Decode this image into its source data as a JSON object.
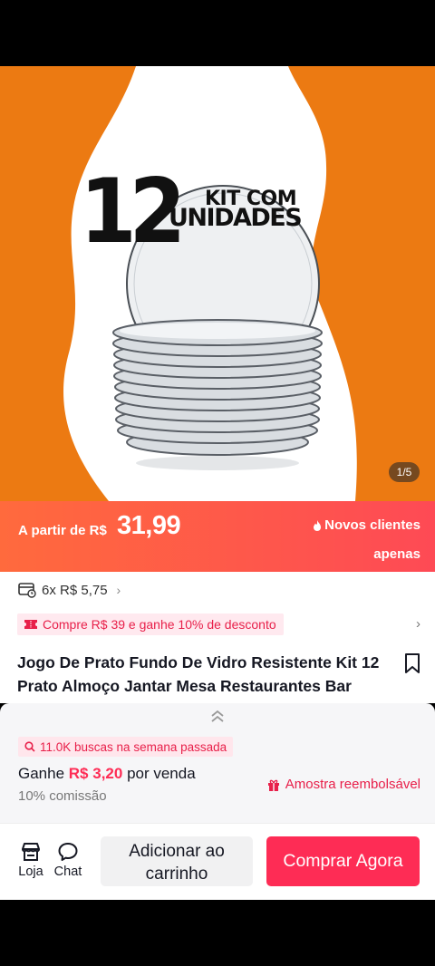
{
  "hero": {
    "number": "12",
    "kit_text": "KIT COM",
    "units_text": "UNIDADES",
    "page_indicator": "1/5",
    "colors": {
      "background": "#ec7a12",
      "blob": "#ffffff"
    }
  },
  "price": {
    "prefix": "A partir de R$",
    "value": "31,99",
    "promo_line1": "Novos clientes",
    "promo_line2": "apenas"
  },
  "installments": {
    "text": "6x R$ 5,75"
  },
  "coupon": {
    "text": "Compre R$ 39 e ganhe 10% de desconto"
  },
  "product": {
    "title": "Jogo De Prato Fundo De Vidro Resistente Kit 12 Prato Almoço Jantar Mesa Restaurantes Bar"
  },
  "affiliate": {
    "searches": "11.0K buscas na semana passada",
    "earn_prefix": "Ganhe",
    "earn_amount": "R$ 3,20",
    "earn_suffix": "por venda",
    "commission": "10% comissão",
    "sample": "Amostra reembolsável"
  },
  "actions": {
    "store_label": "Loja",
    "chat_label": "Chat",
    "cart_line1": "Adicionar ao",
    "cart_line2": "carrinho",
    "buy_label": "Comprar Agora"
  },
  "colors": {
    "accent": "#fe2c55",
    "price_gradient_start": "#ff6a3d",
    "price_gradient_end": "#fe4a55"
  }
}
